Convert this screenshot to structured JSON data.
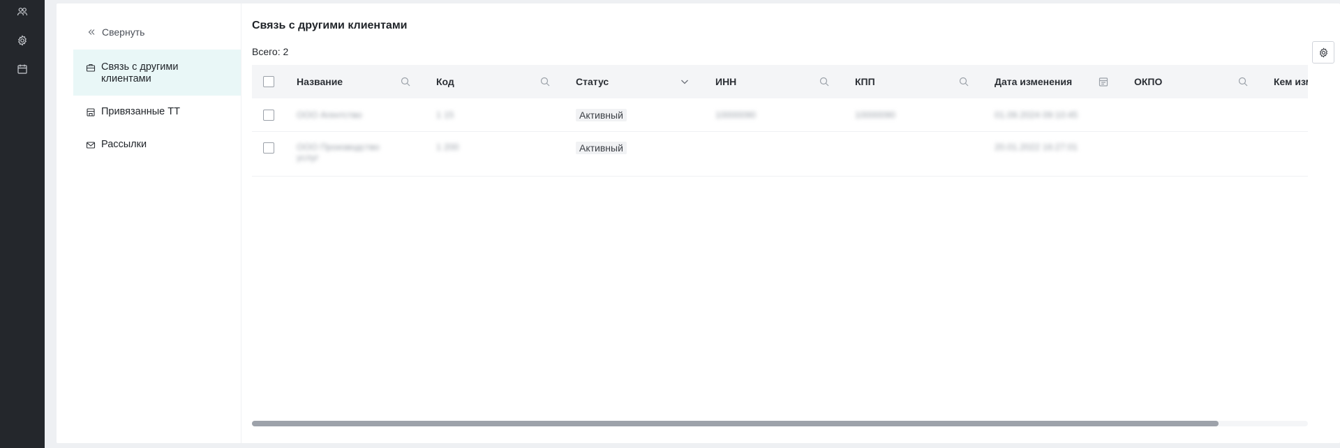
{
  "rail": {
    "icons": [
      "users-icon",
      "gear-icon",
      "calendar-icon"
    ]
  },
  "sidenav": {
    "collapse_label": "Свернуть",
    "items": [
      {
        "label": "Связь с другими клиентами",
        "icon": "briefcase-icon",
        "active": true
      },
      {
        "label": "Привязанные ТТ",
        "icon": "store-icon",
        "active": false
      },
      {
        "label": "Рассылки",
        "icon": "mail-icon",
        "active": false
      }
    ]
  },
  "page": {
    "title": "Связь с другими клиентами",
    "total": "Всего: 2"
  },
  "table": {
    "columns": [
      "Название",
      "Код",
      "Статус",
      "ИНН",
      "КПП",
      "Дата изменения",
      "ОКПО",
      "Кем изм"
    ],
    "rows": [
      {
        "name": "ООО Агентство",
        "code": "1 15",
        "status": "Активный",
        "inn": "10000090",
        "kpp": "10000090",
        "date": "01.09.2024 09:10:45"
      },
      {
        "name": "ООО Производство услуг",
        "code": "1 200",
        "status": "Активный",
        "inn": "",
        "kpp": "",
        "date": "20.01.2022 16:27:01"
      }
    ]
  },
  "scrollbar": {
    "position_fraction": 0.0,
    "visible_fraction": 0.915
  },
  "colors": {
    "rail_bg": "#24272c",
    "active_nav_bg": "#e9f7f7",
    "header_bg": "#f4f5f7"
  }
}
